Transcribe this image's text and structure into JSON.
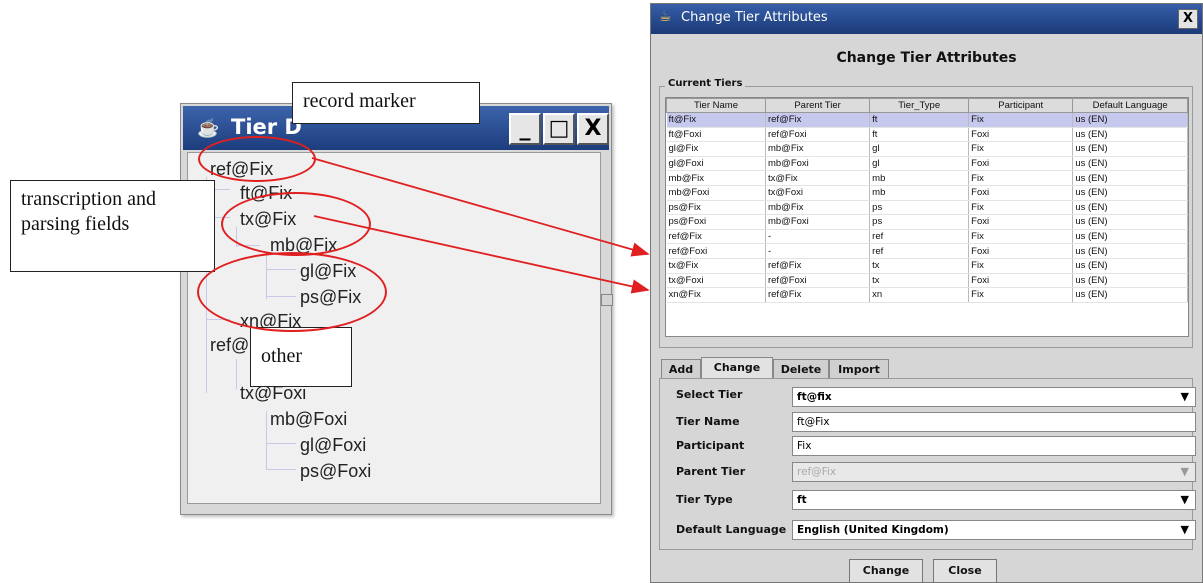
{
  "tier_window": {
    "title": "Tier D",
    "buttons": {
      "minimize": "_",
      "maximize": "□",
      "close": "X"
    },
    "nodes": [
      "ref@Fix",
      "ft@Fix",
      "tx@Fix",
      "mb@Fix",
      "gl@Fix",
      "ps@Fix",
      "xn@Fix",
      "ref@Foxi",
      "tx@Foxi",
      "mb@Foxi",
      "gl@Foxi",
      "ps@Foxi"
    ]
  },
  "callouts": {
    "record_marker": "record marker",
    "transcription": "transcription and parsing fields",
    "other": "other"
  },
  "colors": {
    "annotation": "#e02020",
    "titlebar": "#1d3d7c",
    "selected_row": "#c6c8ee"
  },
  "dialog": {
    "title": "Change Tier Attributes",
    "heading": "Change Tier Attributes",
    "close_label": "X",
    "current_tiers_label": "Current Tiers",
    "columns": [
      "Tier Name",
      "Parent Tier",
      "Tier_Type",
      "Participant",
      "Default Language"
    ],
    "rows": [
      [
        "ft@Fix",
        "ref@Fix",
        "ft",
        "Fix",
        "us (EN)"
      ],
      [
        "ft@Foxi",
        "ref@Foxi",
        "ft",
        "Foxi",
        "us (EN)"
      ],
      [
        "gl@Fix",
        "mb@Fix",
        "gl",
        "Fix",
        "us (EN)"
      ],
      [
        "gl@Foxi",
        "mb@Foxi",
        "gl",
        "Foxi",
        "us (EN)"
      ],
      [
        "mb@Fix",
        "tx@Fix",
        "mb",
        "Fix",
        "us (EN)"
      ],
      [
        "mb@Foxi",
        "tx@Foxi",
        "mb",
        "Foxi",
        "us (EN)"
      ],
      [
        "ps@Fix",
        "mb@Fix",
        "ps",
        "Fix",
        "us (EN)"
      ],
      [
        "ps@Foxi",
        "mb@Foxi",
        "ps",
        "Foxi",
        "us (EN)"
      ],
      [
        "ref@Fix",
        "-",
        "ref",
        "Fix",
        "us (EN)"
      ],
      [
        "ref@Foxi",
        "-",
        "ref",
        "Foxi",
        "us (EN)"
      ],
      [
        "tx@Fix",
        "ref@Fix",
        "tx",
        "Fix",
        "us (EN)"
      ],
      [
        "tx@Foxi",
        "ref@Foxi",
        "tx",
        "Foxi",
        "us (EN)"
      ],
      [
        "xn@Fix",
        "ref@Fix",
        "xn",
        "Fix",
        "us (EN)"
      ]
    ],
    "tabs": [
      "Add",
      "Change",
      "Delete",
      "Import"
    ],
    "active_tab": "Change",
    "form": {
      "select_tier_label": "Select Tier",
      "select_tier_value": "ft@fix",
      "tier_name_label": "Tier Name",
      "tier_name_value": "ft@Fix",
      "participant_label": "Participant",
      "participant_value": "Fix",
      "parent_tier_label": "Parent Tier",
      "parent_tier_value": "ref@Fix",
      "tier_type_label": "Tier Type",
      "tier_type_value": "ft",
      "default_language_label": "Default Language",
      "default_language_value": "English (United Kingdom)"
    },
    "change_button": "Change",
    "close_button": "Close"
  }
}
